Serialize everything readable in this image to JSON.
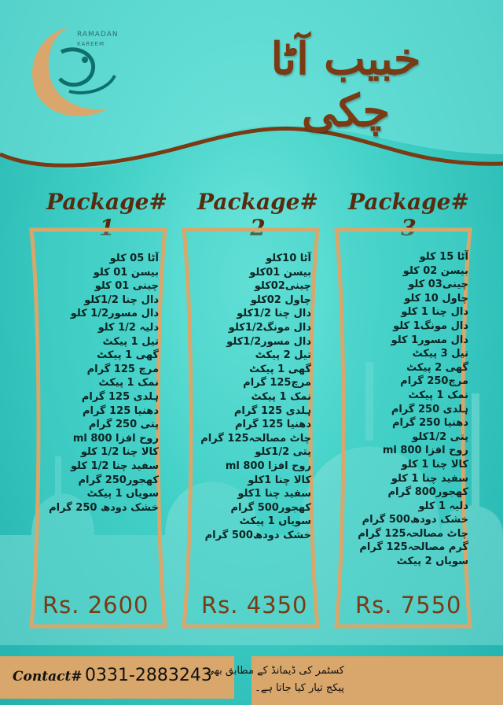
{
  "brand": {
    "title": "خبیب آٹا چکی",
    "logo_text_line1": "RAMADAN",
    "logo_text_line2": "KAREEM"
  },
  "packages": [
    {
      "name": "Package# 1",
      "items": [
        "آٹا 05 کلو",
        "بیسن 01 کلو",
        "چینی 01 کلو",
        "دال چنا 1/2کلو",
        "دال مسور1/2 کلو",
        "دلیہ 1/2 کلو",
        "تیل 1 پیکٹ",
        "گھی 1 پیکٹ",
        "مرچ 125 گرام",
        "نمک 1 پیکٹ",
        "ہلدی 125 گرام",
        "دھنیا 125 گرام",
        "پتی 250 گرام",
        "روح افزا 800 ml",
        "کالا چنا 1/2 کلو",
        "سفید چنا 1/2 کلو",
        "کھجور250 گرام",
        "سویاں 1 پیکٹ",
        "خشک دودھ 250 گرام"
      ],
      "price": "Rs. 2600"
    },
    {
      "name": "Package# 2",
      "items": [
        "آٹا 10کلو",
        "بیسن 01کلو",
        "چینی02کلو",
        "چاول 02کلو",
        "دال چنا 1/2کلو",
        "دال مونگ1/2کلو",
        "دال مسور1/2کلو",
        "تیل 2 پیکٹ",
        "گھی 1 پیکٹ",
        "مرچ125 گرام",
        "نمک 1 پیکٹ",
        "ہلدی 125 گرام",
        "دھنیا 125 گرام",
        "چاٹ مصالحہ125 گرام",
        "پتی 1/2کلو",
        "روح افزا 800 ml",
        "کالا چنا 1کلو",
        "سفید چنا 1کلو",
        "کھجور500 گرام",
        "سویاں 1 پیکٹ",
        "خشک دودھ500 گرام"
      ],
      "price": "Rs. 4350"
    },
    {
      "name": "Package# 3",
      "items": [
        "آٹا 15 کلو",
        "بیسن 02 کلو",
        "چینی03 کلو",
        "چاول 10 کلو",
        "دال چنا 1 کلو",
        "دال مونگ1 کلو",
        "دال مسور1 کلو",
        "تیل 3 پیکٹ",
        "گھی 2 پیکٹ",
        "مرچ250 گرام",
        "نمک 1 پیکٹ",
        "ہلدی 250 گرام",
        "دھنیا 250 گرام",
        "پتی 1/2کلو",
        "روح افزا 800 ml",
        "کالا چنا 1 کلو",
        "سفید چنا 1 کلو",
        "کھجور800 گرام",
        "دلیہ 1 کلو",
        "خشک دودھ500 گرام",
        "چاٹ مصالحہ125 گرام",
        "گرم مصالحہ125 گرام",
        "سویاں 2 پیکٹ"
      ],
      "price": "Rs. 7550"
    }
  ],
  "contact": {
    "label": "Contact#",
    "number": "0331-2883243"
  },
  "note": {
    "line1": "کسٹمر کی ڈیمانڈ کے مطابق بھی",
    "line2": "پیکج تیار کیا جاتا ہے۔"
  },
  "colors": {
    "background": "#3fcfc6",
    "frame": "#d9a66b",
    "title": "#7a3a14"
  }
}
